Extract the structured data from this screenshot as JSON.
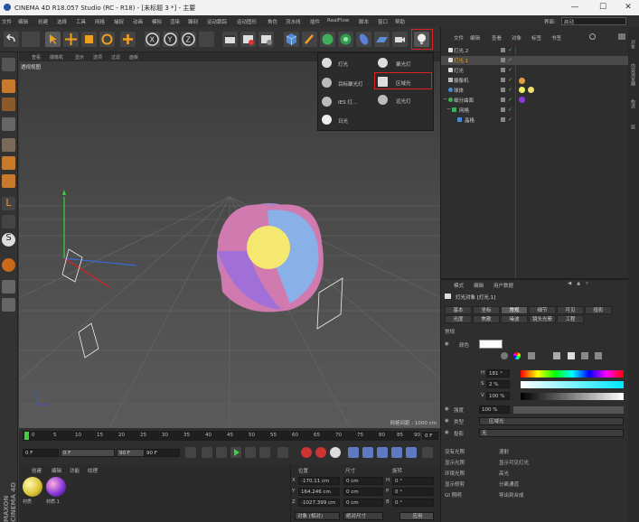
{
  "window": {
    "title": "CINEMA 4D R18.057 Studio (RC - R18) - [未标题 3 *] - 主要",
    "minimize": "—",
    "maximize": "☐",
    "close": "✕"
  },
  "menu": {
    "items": [
      "文件",
      "编辑",
      "创建",
      "选择",
      "工具",
      "网格",
      "捕捉",
      "动画",
      "模拟",
      "渲染",
      "雕刻",
      "运动跟踪",
      "运动图形",
      "角色",
      "流水线",
      "插件",
      "RealFlow",
      "脚本",
      "窗口",
      "帮助"
    ],
    "layout_label": "界面:",
    "layout_value": "启动"
  },
  "viewport": {
    "tabs": [
      "查看",
      "摄像机",
      "显示",
      "选项",
      "过滤",
      "面板"
    ],
    "name": "透视视图",
    "grid_spacing": "网格间距 : 1000 cm"
  },
  "light_popup": {
    "items": [
      "灯光",
      "目标聚光灯",
      "IES 灯...",
      "日光",
      "聚光灯",
      "区域光",
      "远光灯"
    ]
  },
  "object_manager": {
    "tabs": [
      "文件",
      "编辑",
      "查看",
      "对象",
      "标签",
      "书签"
    ],
    "objects": [
      "灯光.2",
      "灯光.1",
      "灯光",
      "摄像机",
      "球体",
      "细分曲面",
      "网格",
      "晶格"
    ]
  },
  "attributes": {
    "tabs": [
      "模式",
      "编辑",
      "用户数据"
    ],
    "title": "灯光对象 [灯光.1]",
    "subtabs_row1": [
      "基本",
      "坐标",
      "常规",
      "细节",
      "可见",
      "投影"
    ],
    "subtabs_row2": [
      "光度",
      "焦散",
      "噪波",
      "镜头光晕",
      "工程"
    ],
    "section": "常规",
    "color_label": "颜色",
    "h_label": "H",
    "h_value": "181 °",
    "s_label": "S",
    "s_value": "2 %",
    "v_label": "V",
    "v_value": "100 %",
    "intensity_label": "强度",
    "intensity_value": "100 %",
    "type_label": "类型",
    "type_value": "区域光",
    "shadow_label": "投影",
    "shadow_value": "无",
    "options": [
      "没有光照",
      "显示光照",
      "环境光照",
      "显示修剪",
      "漫射",
      "高光",
      "GI 照明",
      "显示可见灯光",
      "分离通道",
      "导出到合成"
    ]
  },
  "timeline": {
    "ticks": [
      "0",
      "5",
      "10",
      "15",
      "20",
      "25",
      "30",
      "35",
      "40",
      "45",
      "50",
      "55",
      "60",
      "65",
      "70",
      "75",
      "80",
      "85",
      "90"
    ],
    "current_frame": "0 F",
    "start": "0 F",
    "min": "0 F",
    "max": "90 F",
    "end": "90 F"
  },
  "materials": {
    "tabs": [
      "创建",
      "编辑",
      "功能",
      "纹理"
    ],
    "items": [
      "材质",
      "材质.1"
    ]
  },
  "coordinates": {
    "headers": [
      "位置",
      "尺寸",
      "旋转"
    ],
    "rows": [
      {
        "axis": "X",
        "pos": "-170.11 cm",
        "size": "0 cm",
        "rot_axis": "H",
        "rot": "0 °"
      },
      {
        "axis": "Y",
        "pos": "164.246 cm",
        "size": "0 cm",
        "rot_axis": "P",
        "rot": "0 °"
      },
      {
        "axis": "Z",
        "pos": "-1027.399 cm",
        "size": "0 cm",
        "rot_axis": "B",
        "rot": "0 °"
      }
    ],
    "mode": "对象 (相对)",
    "size_mode": "绝对尺寸",
    "apply": "应用"
  },
  "brand": "MAXON CINEMA 4D",
  "right_strip": [
    "对象",
    "内容浏览器",
    "构造",
    "层"
  ],
  "colors": {
    "accent_red": "#e02020",
    "orange_icon": "#f0a020",
    "blue_icon": "#4a8ad6"
  }
}
